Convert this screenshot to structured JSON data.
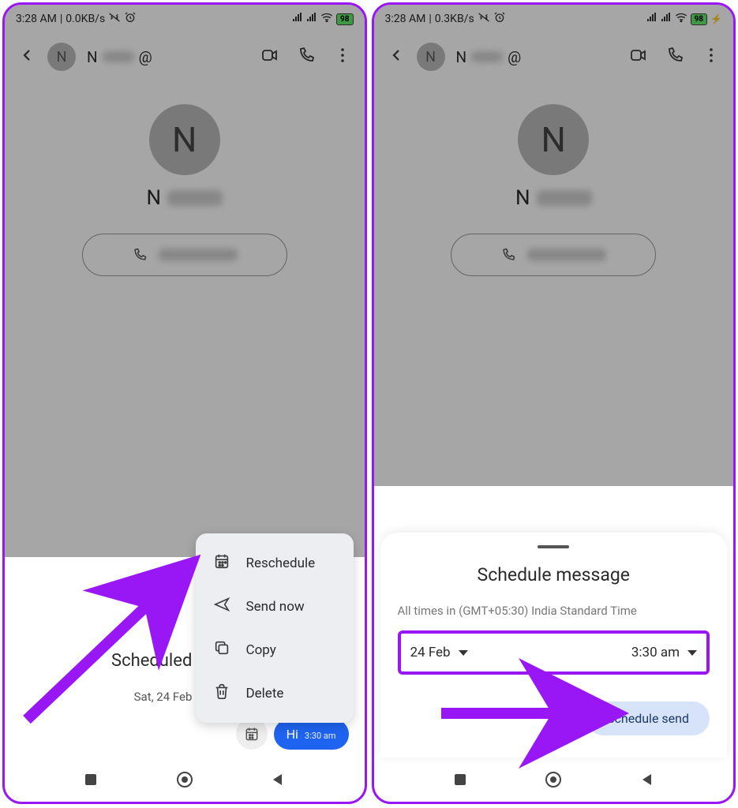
{
  "left": {
    "status": {
      "time": "3:28 AM",
      "net": "0.0KB/s",
      "battery": "98"
    },
    "contact": {
      "initial": "N",
      "name_prefix": "N"
    },
    "menu": {
      "reschedule": "Reschedule",
      "send_now": "Send now",
      "copy": "Copy",
      "delete": "Delete"
    },
    "scheduled": {
      "heading": "Scheduled message",
      "date": "Sat, 24 Feb • 3:30 am",
      "msg_text": "Hi",
      "msg_time": "3:30 am"
    }
  },
  "right": {
    "status": {
      "time": "3:28 AM",
      "net": "0.3KB/s",
      "battery": "98"
    },
    "contact": {
      "initial": "N",
      "name_prefix": "N"
    },
    "sheet": {
      "title": "Schedule message",
      "meta": "All times in (GMT+05:30) India Standard Time",
      "date": "24 Feb",
      "time": "3:30 am",
      "button": "Schedule send"
    }
  }
}
